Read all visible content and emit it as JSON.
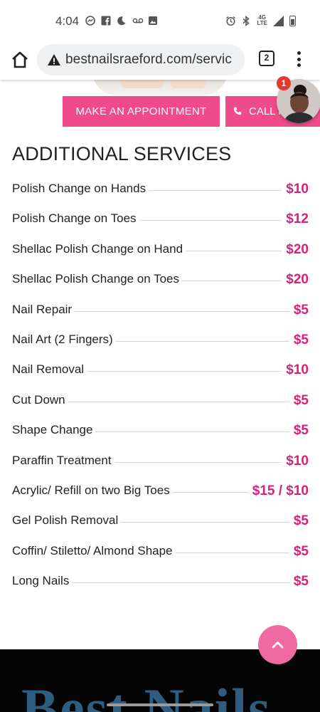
{
  "status_bar": {
    "time": "4:04",
    "network": "4G LTE",
    "left_icons": [
      "messenger-icon",
      "facebook-icon",
      "moon-icon",
      "voicemail-icon",
      "image-icon"
    ],
    "right_icons": [
      "alarm-icon",
      "bluetooth-icon",
      "signal-icon",
      "battery-icon"
    ]
  },
  "browser": {
    "url": "bestnailsraeford.com/servic",
    "tab_count": "2"
  },
  "buttons": {
    "appointment": "MAKE AN APPOINTMENT",
    "call": "CALL N"
  },
  "chat": {
    "badge": "1"
  },
  "section": {
    "title": "ADDITIONAL SERVICES"
  },
  "services": [
    {
      "name": "Polish Change on Hands",
      "price": "$10"
    },
    {
      "name": "Polish Change on Toes",
      "price": "$12"
    },
    {
      "name": "Shellac Polish Change on Hand",
      "price": "$20"
    },
    {
      "name": "Shellac Polish Change on Toes",
      "price": "$20"
    },
    {
      "name": "Nail Repair",
      "price": "$5"
    },
    {
      "name": "Nail Art (2 Fingers)",
      "price": "$5"
    },
    {
      "name": "Nail Removal",
      "price": "$10"
    },
    {
      "name": "Cut Down",
      "price": "$5"
    },
    {
      "name": "Shape Change",
      "price": "$5"
    },
    {
      "name": "Paraffin Treatment",
      "price": "$10"
    },
    {
      "name": "Acrylic/ Refill on two Big Toes",
      "price": "$15 / $10"
    },
    {
      "name": "Gel Polish Removal",
      "price": "$5"
    },
    {
      "name": "Coffin/ Stiletto/ Almond Shape",
      "price": "$5"
    },
    {
      "name": "Long Nails",
      "price": "$5"
    }
  ],
  "footer": {
    "logo_text": "Best Nails"
  },
  "colors": {
    "accent": "#ef4b8c",
    "price": "#d6217a",
    "scroll_button": "#ef6aa3",
    "footer_bg": "#050505",
    "footer_logo": "#2e5d82"
  }
}
